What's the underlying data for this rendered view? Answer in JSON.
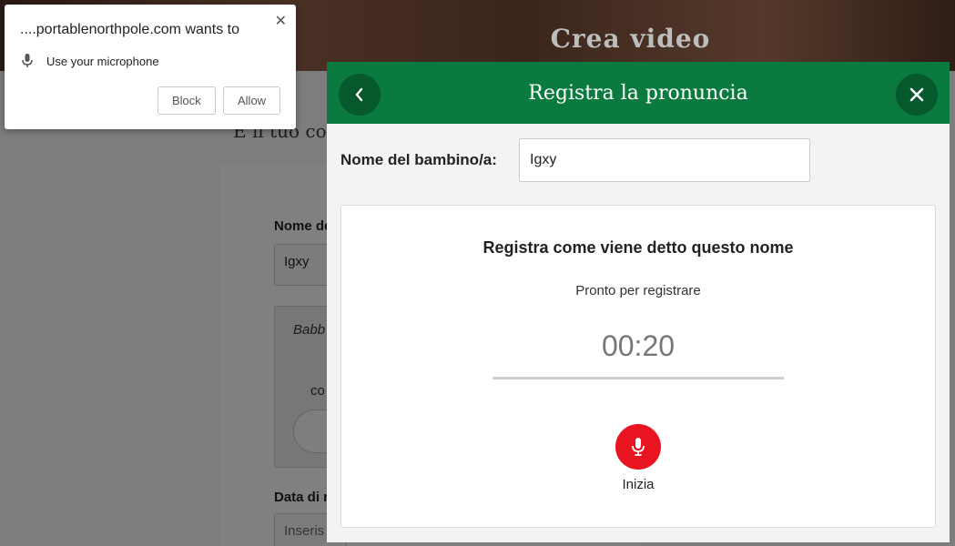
{
  "background": {
    "header_title": "Crea video",
    "subtitle": "È il tuo co",
    "name_label": "Nome de",
    "name_value": "Igxy",
    "italic_text": "Babb",
    "co_text": "co",
    "date_label": "Data di r",
    "date_placeholder": "Inseris"
  },
  "permission": {
    "title": "....portablenorthpole.com wants to",
    "request": "Use your microphone",
    "block_label": "Block",
    "allow_label": "Allow",
    "close_glyph": "✕"
  },
  "modal": {
    "title": "Registra la pronuncia",
    "name_label": "Nome del bambino/a:",
    "name_value": "Igxy",
    "record_heading": "Registra come viene detto questo nome",
    "status": "Pronto per registrare",
    "timer": "00:20",
    "start_label": "Inizia",
    "colors": {
      "header": "#0b7a3e",
      "record": "#e8141f"
    }
  }
}
